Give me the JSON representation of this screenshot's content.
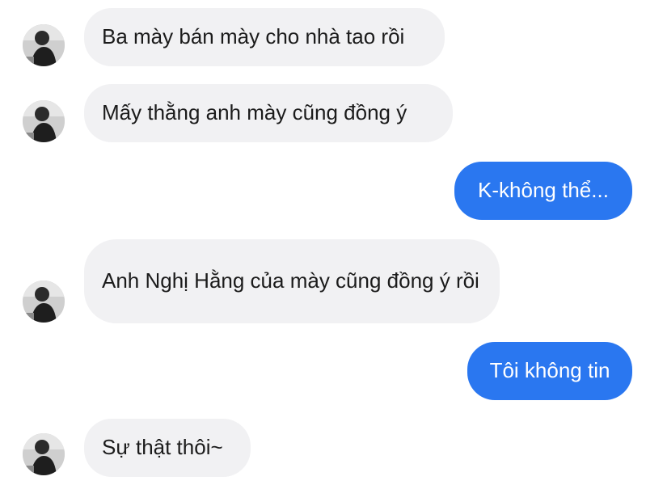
{
  "conversation": {
    "messages": [
      {
        "sender": "other",
        "text": "Ba mày bán mày cho nhà tao rồi"
      },
      {
        "sender": "other",
        "text": "Mấy thằng anh mày cũng đồng ý"
      },
      {
        "sender": "me",
        "text": "K-không thể..."
      },
      {
        "sender": "other",
        "text": "Anh Nghị Hằng của mày cũng đồng ý rồi"
      },
      {
        "sender": "me",
        "text": "Tôi không tin"
      },
      {
        "sender": "other",
        "text": "Sự thật thôi~"
      }
    ],
    "colors": {
      "incoming_bubble": "#f1f1f3",
      "outgoing_bubble": "#2a77f0",
      "outgoing_text": "#ffffff"
    },
    "avatar_icon": "contact-avatar-photo"
  }
}
